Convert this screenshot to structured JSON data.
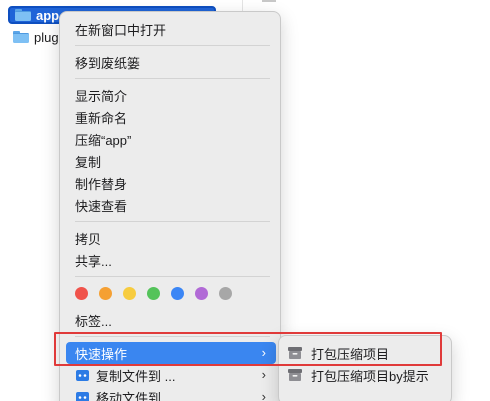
{
  "files": [
    {
      "name": "app",
      "selected": true
    },
    {
      "name": "plug",
      "selected": false
    }
  ],
  "menu": {
    "open_new_window": "在新窗口中打开",
    "move_to_trash": "移到废纸篓",
    "get_info": "显示简介",
    "rename": "重新命名",
    "compress": "压缩“app”",
    "duplicate": "复制",
    "make_alias": "制作替身",
    "quick_look": "快速查看",
    "copy": "拷贝",
    "share": "共享...",
    "tags_label": "标签...",
    "tag_colors": [
      "#f0534b",
      "#f5a033",
      "#f7cc3f",
      "#54c35a",
      "#3b86f5",
      "#b16ad6",
      "#a7a7a7"
    ],
    "quick_actions": "快速操作",
    "copy_files_to": "复制文件到 ...",
    "move_files_to": "移动文件到 ...",
    "highlight_color": "#3a86f0"
  },
  "submenu": {
    "pack_compress": "打包压缩项目",
    "pack_compress_prompt": "打包压缩项目by提示"
  },
  "annotation_color": "#e03a3a"
}
